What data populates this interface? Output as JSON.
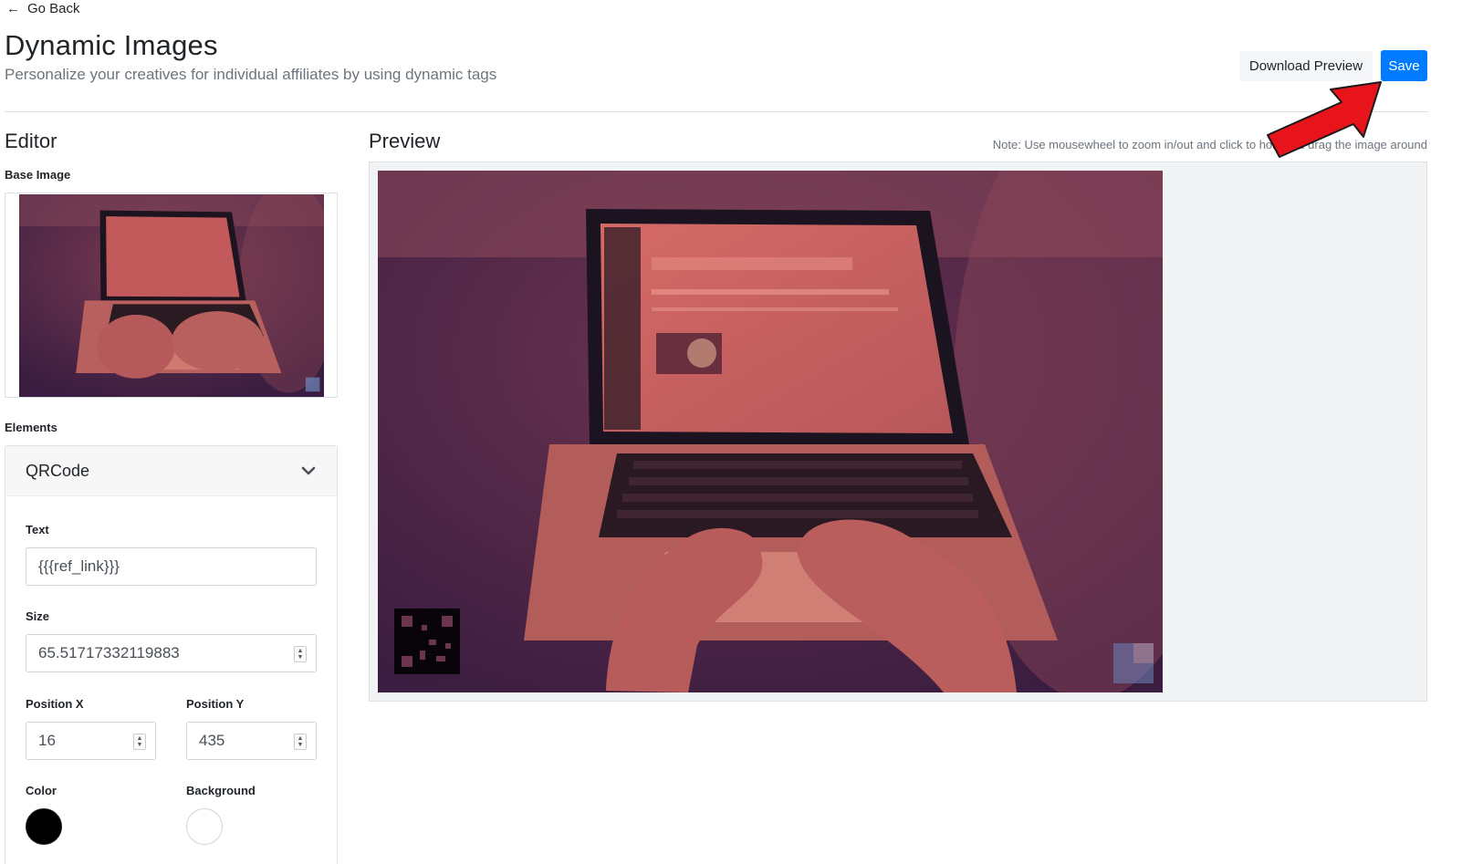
{
  "nav": {
    "back_icon": "arrow-left-icon",
    "back_label": "Go Back"
  },
  "header": {
    "title": "Dynamic Images",
    "subtitle": "Personalize your creatives for individual affiliates by using dynamic tags",
    "download_label": "Download Preview",
    "save_label": "Save"
  },
  "colors": {
    "primary": "#007bff",
    "annotation_arrow": "#e8141b",
    "tint": "#c95556",
    "shadow": "#3a1d40"
  },
  "editor": {
    "title": "Editor",
    "base_image_label": "Base Image",
    "elements_label": "Elements",
    "element": {
      "name": "QRCode",
      "expand_icon": "chevron-down-icon",
      "text_label": "Text",
      "text_value": "{{{ref_link}}}",
      "size_label": "Size",
      "size_value": "65.51717332119883",
      "posx_label": "Position X",
      "posx_value": "16",
      "posy_label": "Position Y",
      "posy_value": "435",
      "color_label": "Color",
      "color_value": "#000000",
      "background_label": "Background",
      "background_value": "#ffffff"
    }
  },
  "preview": {
    "title": "Preview",
    "note": "Note: Use mousewheel to zoom in/out and click to hold and drag the image around"
  }
}
